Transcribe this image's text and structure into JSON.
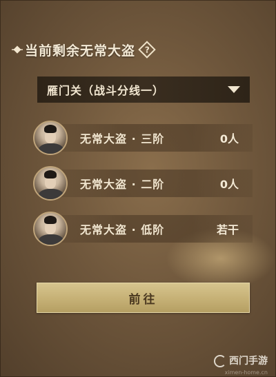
{
  "header": {
    "title": "当前剩余无常大盗",
    "help_icon": "?"
  },
  "dropdown": {
    "selected": "雁门关（战斗分线一）"
  },
  "rows": [
    {
      "name": "无常大盗 · 三阶",
      "count": "0人",
      "icon": "bandit-portrait"
    },
    {
      "name": "无常大盗 · 二阶",
      "count": "0人",
      "icon": "bandit-portrait"
    },
    {
      "name": "无常大盗 · 低阶",
      "count": "若干",
      "icon": "bandit-portrait"
    }
  ],
  "action": {
    "go_label": "前往"
  },
  "watermark": {
    "text": "西门手游",
    "sub": "ximen-home.cn"
  },
  "colors": {
    "background": "#6f573c",
    "dropdown_bg": "#2e2418",
    "button_gold": "#c7b277",
    "text_light": "#f1e6d0"
  }
}
